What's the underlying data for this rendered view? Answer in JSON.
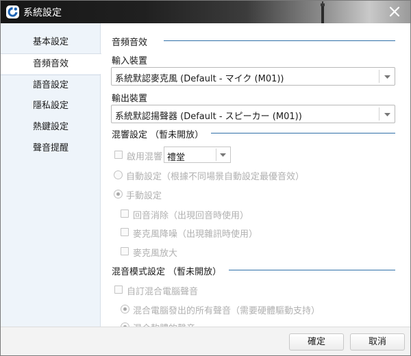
{
  "window": {
    "title": "系統設定"
  },
  "sidebar": {
    "items": [
      {
        "label": "基本設定"
      },
      {
        "label": "音頻音效"
      },
      {
        "label": "語音設定"
      },
      {
        "label": "隱私設定"
      },
      {
        "label": "熱鍵設定"
      },
      {
        "label": "聲音提醒"
      }
    ],
    "active_index": 1
  },
  "audio": {
    "section_title": "音頻音效",
    "input_label": "輸入裝置",
    "input_value": "系統默認麥克風 (Default - マイク (M01))",
    "output_label": "輸出裝置",
    "output_value": "系統默認揚聲器 (Default - スピーカー (M01))"
  },
  "reverb": {
    "section_title": "混響設定 （暫未開放）",
    "enable_label": "啟用混響",
    "preset_value": "禮堂",
    "auto_label": "自動設定（根據不同場景自動設定最優音效）",
    "manual_label": "手動設定",
    "manual_selected": true,
    "echo_cancel_label": "回音消除（出現回音時使用）",
    "noise_reduce_label": "麥克風降噪（出現雜訊時使用）",
    "amplify_label": "麥克風放大"
  },
  "mix": {
    "section_title": "混音模式設定 （暫未開放）",
    "custom_label": "自訂混合電腦聲音",
    "all_sounds_label": "混合電腦發出的所有聲音（需要硬體驅動支持）",
    "partial_label": "混合軟體的聲音"
  },
  "footer": {
    "ok_label": "確定",
    "cancel_label": "取消"
  },
  "colors": {
    "accent_line": "#2f6fa8",
    "sidebar_bg": "#eef4fa",
    "disabled_text": "#b0b0b0"
  }
}
